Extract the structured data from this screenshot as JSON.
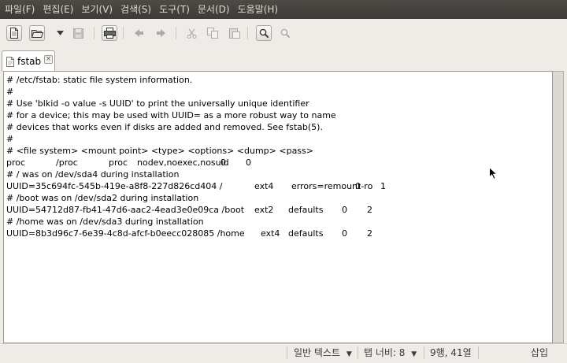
{
  "menubar": {
    "items": [
      "파일(F)",
      "편집(E)",
      "보기(V)",
      "검색(S)",
      "도구(T)",
      "문서(D)",
      "도움말(H)"
    ]
  },
  "toolbar": {
    "buttons": [
      {
        "icon": "new-document-icon",
        "enabled": true
      },
      {
        "icon": "open-folder-icon",
        "enabled": true
      },
      {
        "icon": "recent-dropdown-arrow-icon",
        "enabled": true
      },
      {
        "icon": "save-icon",
        "enabled": false
      },
      {
        "icon": "print-icon",
        "enabled": true
      },
      {
        "icon": "undo-icon",
        "enabled": false
      },
      {
        "icon": "redo-icon",
        "enabled": false
      },
      {
        "icon": "cut-icon",
        "enabled": false
      },
      {
        "icon": "copy-icon",
        "enabled": false
      },
      {
        "icon": "paste-icon",
        "enabled": false
      },
      {
        "icon": "find-icon",
        "enabled": true
      },
      {
        "icon": "replace-icon",
        "enabled": false
      }
    ]
  },
  "tabs": [
    {
      "label": "fstab",
      "icon": "text-file-icon",
      "close_glyph": "×"
    }
  ],
  "editor": {
    "lines": [
      [
        "# /etc/fstab: static file system information."
      ],
      [
        "#"
      ],
      [
        "# Use 'blkid -o value -s UUID' to print the universally unique identifier"
      ],
      [
        "# for a device; this may be used with UUID= as a more robust way to name"
      ],
      [
        "# devices that works even if disks are added and removed. See fstab(5)."
      ],
      [
        "#"
      ],
      [
        "# <file system> <mount point>   <type>  <options>       <dump>  <pass>"
      ],
      [
        "proc",
        "/proc",
        "proc",
        "nodev,noexec,nosuid",
        "0",
        "0"
      ],
      [
        "# / was on /dev/sda4 during installation"
      ],
      [
        "UUID=35c694fc-545b-419e-a8f8-227d826cd404 /",
        "ext4",
        "errors=remount-ro",
        "0",
        "1"
      ],
      [
        "# /boot was on /dev/sda2 during installation"
      ],
      [
        "UUID=54712d87-fb41-47d6-aac2-4ead3e0e09ca /boot",
        "ext2",
        "defaults",
        "0",
        "2"
      ],
      [
        "# /home was on /dev/sda3 during installation"
      ],
      [
        "UUID=8b3d96c7-6e39-4c8d-afcf-b0eecc028085 /home",
        "ext4",
        "defaults",
        "0",
        "2"
      ]
    ]
  },
  "statusbar": {
    "language": "일반 텍스트",
    "language_arrow": "▼",
    "tab_width": "탭 너비: 8",
    "tab_width_arrow": "▼",
    "position": "9행, 41열",
    "mode": "삽입"
  }
}
